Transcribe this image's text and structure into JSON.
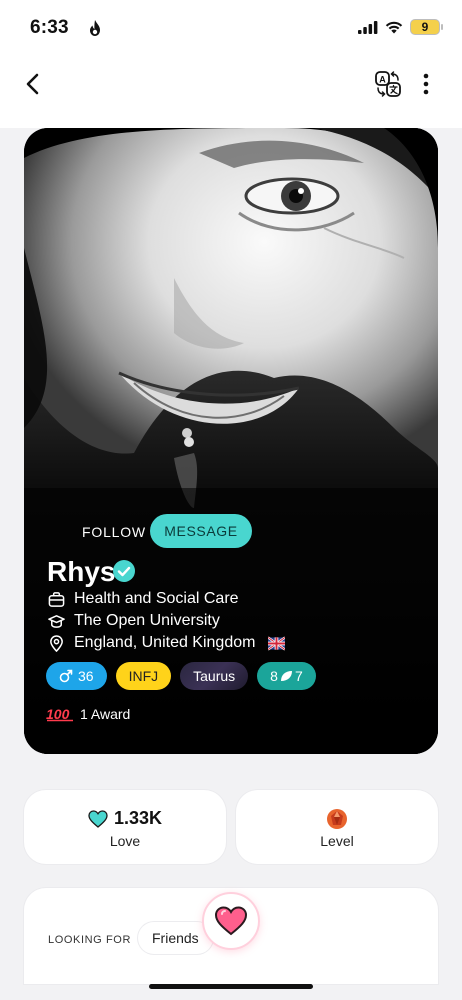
{
  "status": {
    "time": "6:33",
    "battery": "9"
  },
  "profile": {
    "name": "Rhys",
    "follow_label": "FOLLOW",
    "message_label": "MESSAGE",
    "occupation": "Health and Social Care",
    "school": "The Open University",
    "location": "England, United Kingdom",
    "tags": {
      "gender_age": "36",
      "mbti": "INFJ",
      "zodiac": "Taurus",
      "level": "8",
      "level_suffix": "7"
    },
    "award_text": "1 Award"
  },
  "stats": {
    "love_value": "1.33K",
    "love_label": "Love",
    "level_label": "Level"
  },
  "looking_for": {
    "label": "LOOKING FOR",
    "value": "Friends"
  },
  "colors": {
    "accent_teal": "#49d6cf",
    "gender_blue": "#1ea5e9",
    "mbti_yellow": "#ffd31a",
    "level_teal": "#1ba59a",
    "heart_pink": "#ff5f8d"
  },
  "icons": [
    "back-icon",
    "translate-icon",
    "more-icon",
    "briefcase-icon",
    "graduation-cap-icon",
    "location-pin-icon",
    "verified-icon",
    "male-icon",
    "leaf-icon",
    "heart-icon",
    "gem-icon"
  ]
}
